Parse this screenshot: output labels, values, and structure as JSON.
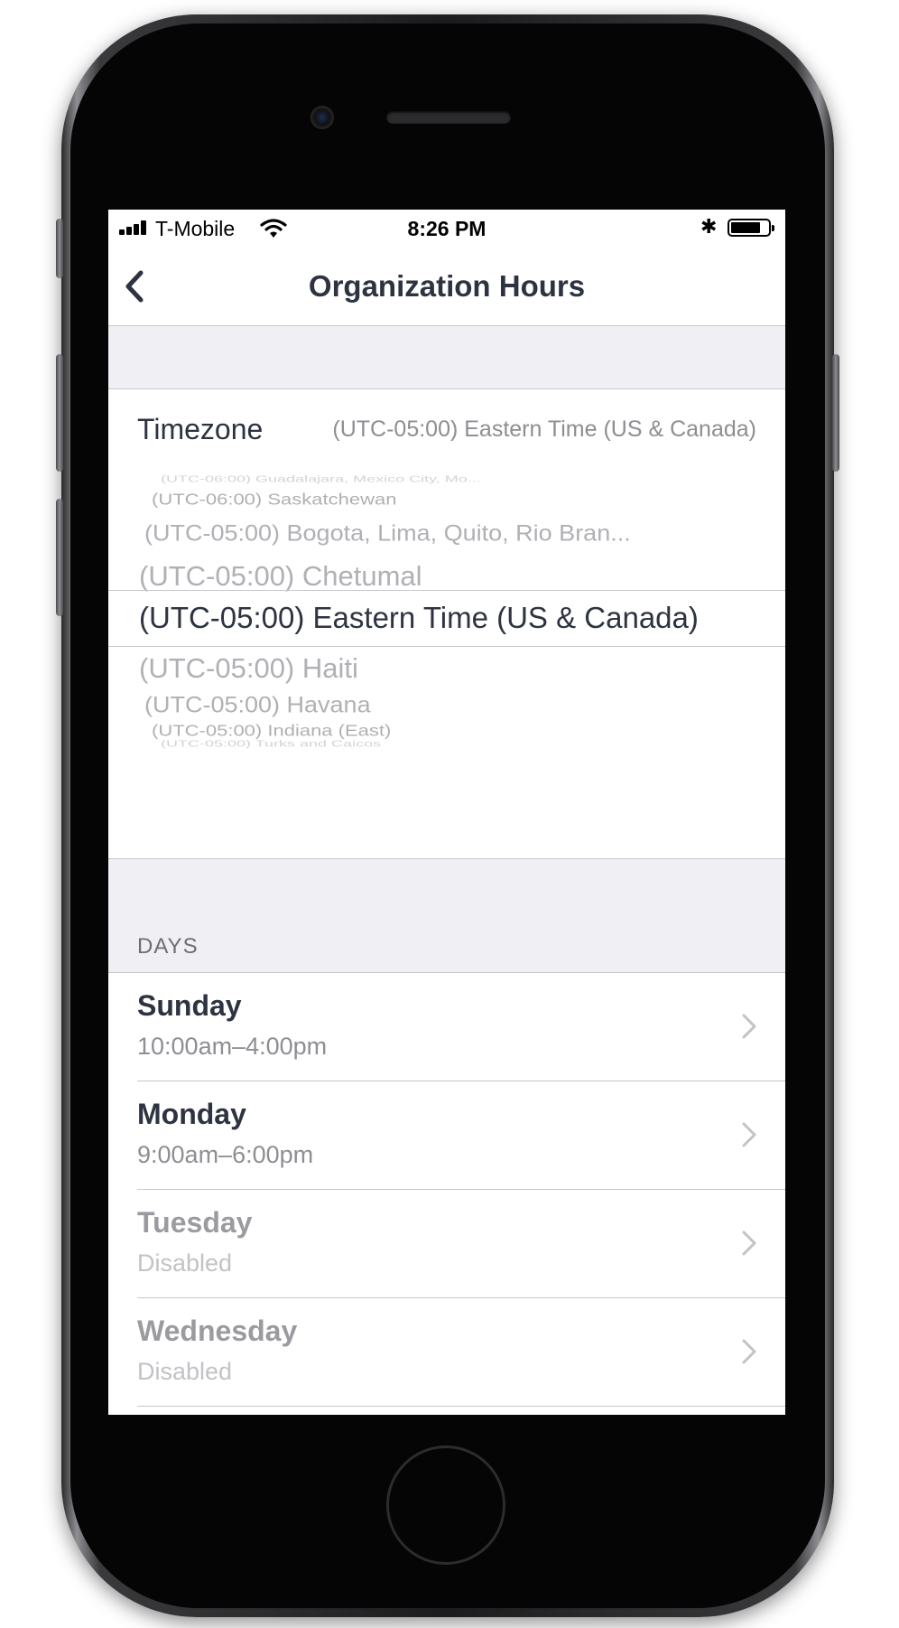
{
  "status_bar": {
    "carrier": "T-Mobile",
    "time": "8:26 PM"
  },
  "nav": {
    "title": "Organization Hours"
  },
  "timezone": {
    "label": "Timezone",
    "value": "(UTC-05:00) Eastern Time (US & Canada)"
  },
  "picker": {
    "options_above": [
      "(UTC-06:00) Guadalajara, Mexico City, Mo...",
      "(UTC-06:00) Saskatchewan",
      "(UTC-05:00) Bogota, Lima, Quito, Rio Bran...",
      "(UTC-05:00) Chetumal"
    ],
    "selected": "(UTC-05:00) Eastern Time (US & Canada)",
    "options_below": [
      "(UTC-05:00) Haiti",
      "(UTC-05:00) Havana",
      "(UTC-05:00) Indiana (East)",
      "(UTC-05:00) Turks and Caicos"
    ]
  },
  "days": {
    "header": "DAYS",
    "items": [
      {
        "name": "Sunday",
        "hours": "10:00am–4:00pm",
        "enabled": true
      },
      {
        "name": "Monday",
        "hours": "9:00am–6:00pm",
        "enabled": true
      },
      {
        "name": "Tuesday",
        "hours": "Disabled",
        "enabled": false
      },
      {
        "name": "Wednesday",
        "hours": "Disabled",
        "enabled": false
      }
    ]
  },
  "colors": {
    "title_text": "#2d3340",
    "secondary_text": "#8e8e93",
    "group_background": "#efeff4",
    "separator": "#c8c7cc"
  }
}
